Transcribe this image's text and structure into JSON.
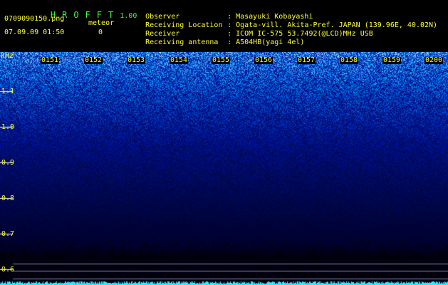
{
  "app": {
    "title": "HROFFT",
    "version": "1.00"
  },
  "file": {
    "name": "0709090150.png",
    "datetime": "07.09.09 01:50"
  },
  "meteor": {
    "label": "meteor",
    "count": "0"
  },
  "info": [
    {
      "label": "Observer",
      "value": "Masayuki Kobayashi"
    },
    {
      "label": "Receiving Location",
      "value": "Ogata-vill. Akita-Pref. JAPAN (139.96E, 40.02N)"
    },
    {
      "label": "Receiver",
      "value": "ICOM IC-575 53.7492(@LCD)MHz USB"
    },
    {
      "label": "Receiving antenna",
      "value": "A504HB(yagi 4el)"
    }
  ],
  "axis": {
    "unit": "kHz",
    "freq_labels": [
      "1.1",
      "1.0",
      "0.9",
      "0.8",
      "0.7",
      "0.6"
    ],
    "time_labels": [
      "0151",
      "0152",
      "0153",
      "0154",
      "0155",
      "0156",
      "0157",
      "0158",
      "0159",
      "0200"
    ]
  },
  "colors": {
    "label_text": "#ffff33",
    "title_text": "#33ff33",
    "background": "#000000",
    "noise_low": "#000a2a",
    "noise_high": "#66ffff"
  }
}
